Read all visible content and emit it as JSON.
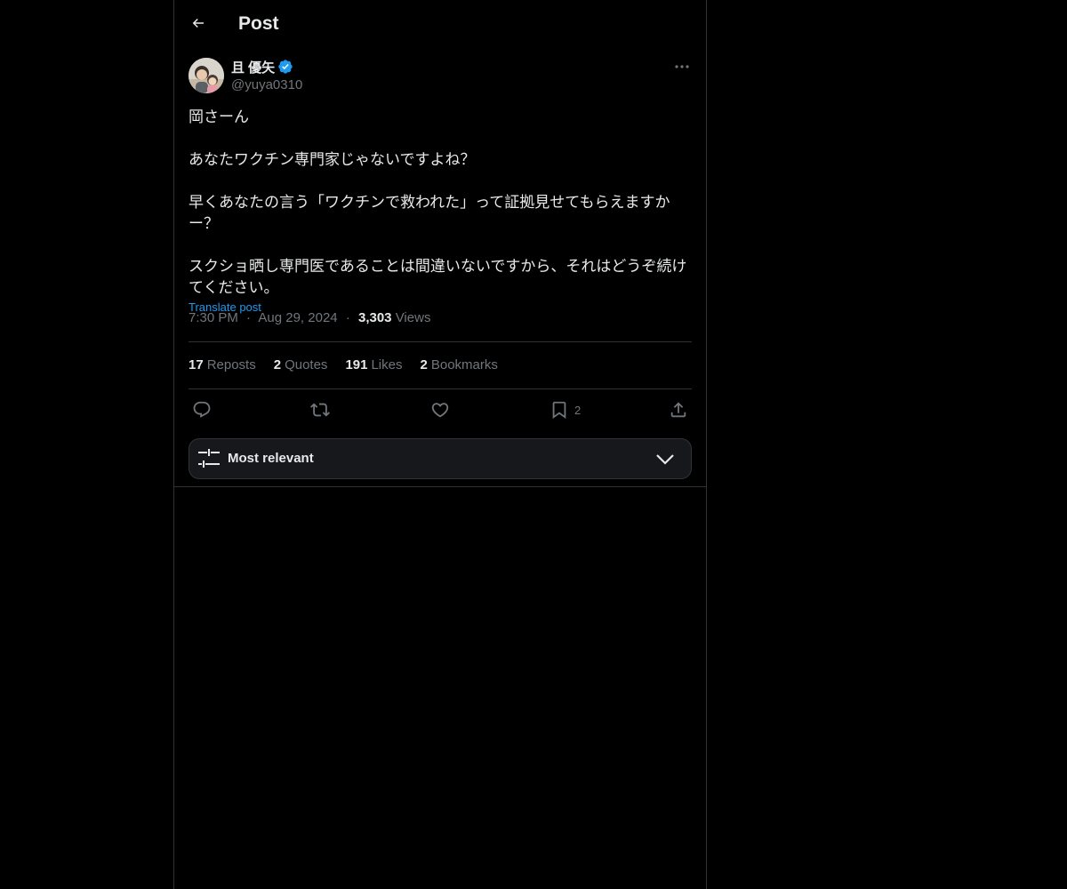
{
  "header": {
    "title": "Post",
    "back_icon": "arrow-left-icon"
  },
  "post": {
    "author": {
      "display_name": "且 優矢",
      "handle": "@yuya0310",
      "verified": true,
      "verified_color": "#1d9bf0"
    },
    "body": "岡さーん\n\nあなたワクチン専門家じゃないですよね？\n\n早くあなたの言う「ワクチンで救われた」って証拠見せてもらえますかー？\n\nスクショ晒し専門医であることは間違いないですから、それはどうぞ続けてください。",
    "translate_label": "Translate post",
    "time": "7:30 PM",
    "separator": "·",
    "date": "Aug 29, 2024",
    "views_count": "3,303",
    "views_label": "Views"
  },
  "stats": [
    {
      "count": "17",
      "label": "Reposts"
    },
    {
      "count": "2",
      "label": "Quotes"
    },
    {
      "count": "191",
      "label": "Likes"
    },
    {
      "count": "2",
      "label": "Bookmarks"
    }
  ],
  "actions": {
    "reply_icon": "reply-icon",
    "repost_icon": "repost-icon",
    "like_icon": "heart-icon",
    "bookmark_icon": "bookmark-icon",
    "bookmark_count": "2",
    "share_icon": "share-icon"
  },
  "sort": {
    "label": "Most relevant",
    "icon": "sliders-icon",
    "chevron": "chevron-down-icon"
  },
  "colors": {
    "background": "#000000",
    "text": "#e7e9ea",
    "muted": "#71767b",
    "accent": "#1d9bf0",
    "border": "#2f3336"
  }
}
